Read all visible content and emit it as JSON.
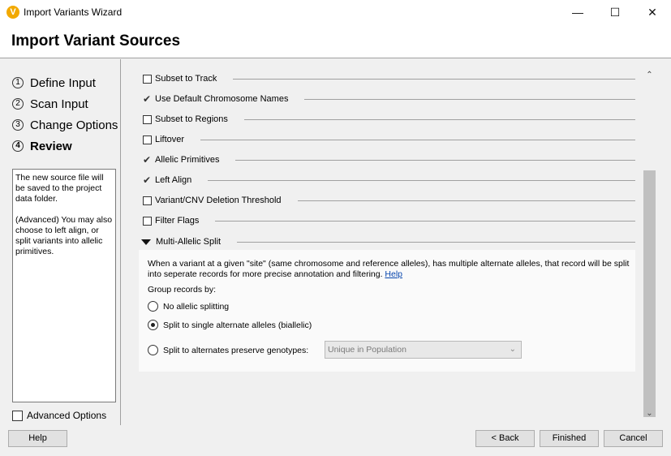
{
  "window": {
    "title": "Import Variants Wizard",
    "app_icon": "V",
    "controls": {
      "minimize": "—",
      "maximize": "☐",
      "close": "✕"
    }
  },
  "header": {
    "title": "Import Variant Sources"
  },
  "steps": [
    {
      "num": "1",
      "label": "Define Input"
    },
    {
      "num": "2",
      "label": "Scan Input"
    },
    {
      "num": "3",
      "label": "Change Options"
    },
    {
      "num": "4",
      "label": "Review"
    }
  ],
  "info_text": "The new source file will be saved to the project data folder.\n\n(Advanced) You may also choose to left align, or split variants into allelic primitives.",
  "advanced_options": {
    "label": "Advanced Options",
    "checked": false
  },
  "options": [
    {
      "label": "Subset to Track",
      "checked": false
    },
    {
      "label": "Use Default Chromosome Names",
      "checked": true
    },
    {
      "label": "Subset to Regions",
      "checked": false
    },
    {
      "label": "Liftover",
      "checked": false
    },
    {
      "label": "Allelic Primitives",
      "checked": true
    },
    {
      "label": "Left Align",
      "checked": true
    },
    {
      "label": "Variant/CNV Deletion Threshold",
      "checked": false
    },
    {
      "label": "Filter Flags",
      "checked": false
    },
    {
      "label": "Multi-Allelic Split",
      "expanded": true
    }
  ],
  "split": {
    "description": "When a variant at a given \"site\" (same chromosome and reference alleles), has multiple alternate alleles, that record will be split into seperate records for more precise annotation and filtering.",
    "help_link": "Help",
    "group_label": "Group records by:",
    "radios": [
      {
        "label": "No allelic splitting",
        "selected": false
      },
      {
        "label": "Split to single alternate alleles (biallelic)",
        "selected": true
      },
      {
        "label": "Split to alternates preserve genotypes:",
        "selected": false
      }
    ],
    "select_value": "Unique in Population"
  },
  "scrollbar": {
    "up": "⌃",
    "down": "⌄"
  },
  "buttons": {
    "help": "Help",
    "back": "< Back",
    "finished": "Finished",
    "cancel": "Cancel"
  }
}
